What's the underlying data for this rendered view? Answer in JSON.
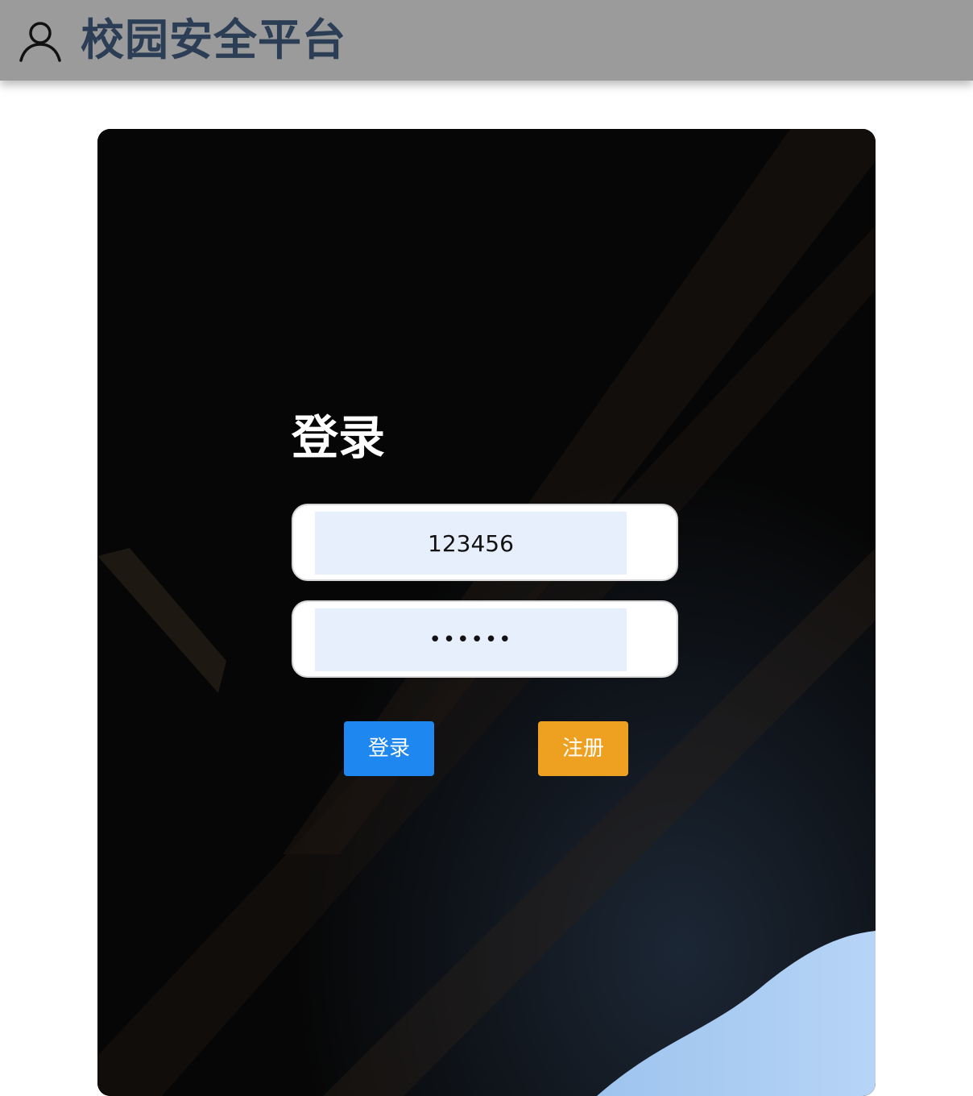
{
  "header": {
    "title": "校园安全平台",
    "icon": "user-icon"
  },
  "login_card": {
    "heading": "登录",
    "username_value": "123456",
    "password_value": "123456",
    "login_button": "登录",
    "register_button": "注册"
  },
  "colors": {
    "header_bg": "#9b9b9b",
    "title": "#2c3e55",
    "login_button": "#1f87f0",
    "register_button": "#eea121",
    "input_bg": "#e7effd"
  }
}
